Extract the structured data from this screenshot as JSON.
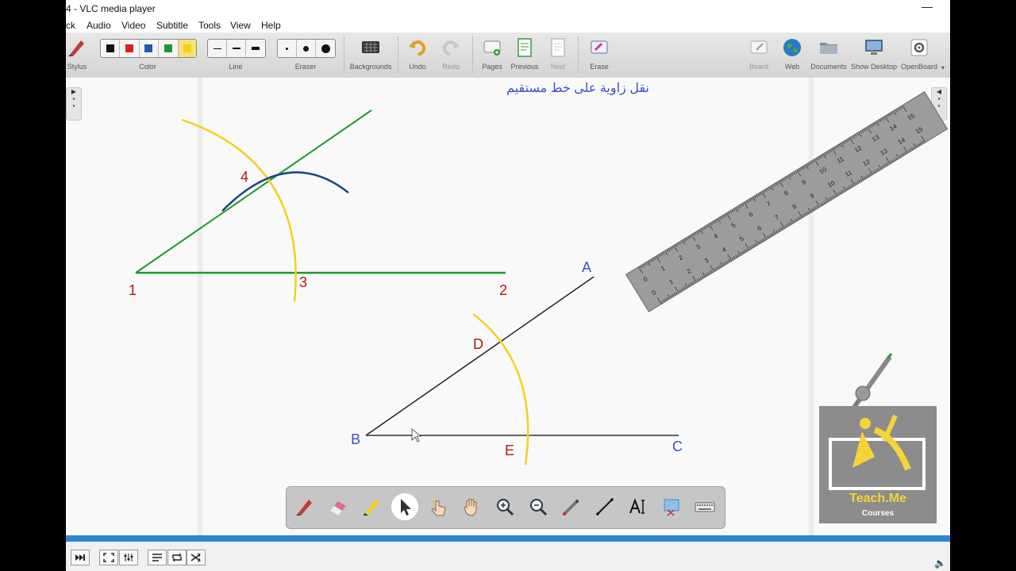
{
  "window": {
    "title": "4 - VLC media player",
    "minimize_glyph": "—"
  },
  "menu": [
    {
      "label": "ck"
    },
    {
      "label": "Audio"
    },
    {
      "label": "Video"
    },
    {
      "label": "Subtitle"
    },
    {
      "label": "Tools"
    },
    {
      "label": "View"
    },
    {
      "label": "Help"
    }
  ],
  "toolbar": {
    "stylus": "Stylus",
    "color": "Color",
    "line": "Line",
    "eraser": "Eraser",
    "backgrounds": "Backgrounds",
    "undo": "Undo",
    "redo": "Redo",
    "pages": "Pages",
    "previous": "Previous",
    "next": "Next",
    "erase": "Erase",
    "board": "Board",
    "web": "Web",
    "documents": "Documents",
    "show_desktop": "Show Desktop",
    "openboard": "OpenBoard",
    "colors": [
      "#111111",
      "#e02020",
      "#1e5bb8",
      "#1a9a2a",
      "#f2d21b"
    ]
  },
  "board": {
    "heading": "نقل زاوية على خط مستقيم",
    "labels": {
      "n1": "1",
      "n2": "2",
      "n3": "3",
      "n4": "4",
      "A": "A",
      "B": "B",
      "C": "C",
      "D": "D",
      "E": "E"
    },
    "ruler_ticks_top": [
      "0",
      "1",
      "2",
      "3",
      "4",
      "5",
      "6",
      "7",
      "8",
      "9",
      "10",
      "11",
      "12",
      "13",
      "14",
      "15"
    ],
    "ruler_ticks_bottom": [
      "0",
      "1",
      "2",
      "3",
      "4",
      "5",
      "6",
      "7",
      "8",
      "9",
      "10",
      "11",
      "12",
      "13",
      "14",
      "15"
    ]
  },
  "palette_tools": [
    {
      "name": "pen-tool-icon"
    },
    {
      "name": "eraser-tool-icon"
    },
    {
      "name": "highlighter-tool-icon"
    },
    {
      "name": "select-tool-icon"
    },
    {
      "name": "interact-tool-icon"
    },
    {
      "name": "hand-tool-icon"
    },
    {
      "name": "zoom-in-icon"
    },
    {
      "name": "zoom-out-icon"
    },
    {
      "name": "laser-pointer-icon"
    },
    {
      "name": "line-tool-icon"
    },
    {
      "name": "text-tool-icon"
    },
    {
      "name": "capture-tool-icon"
    },
    {
      "name": "keyboard-icon"
    }
  ],
  "watermark": {
    "brand": "Teach.Me",
    "sub": "Courses"
  },
  "colors": {
    "accent": "#2f86d0",
    "heading": "#3b50c8",
    "green": "#1a9a2a",
    "yellow": "#f2d21b",
    "navy": "#1a4a7a",
    "red_label": "#b01818",
    "blue_label": "#3b50c8"
  }
}
